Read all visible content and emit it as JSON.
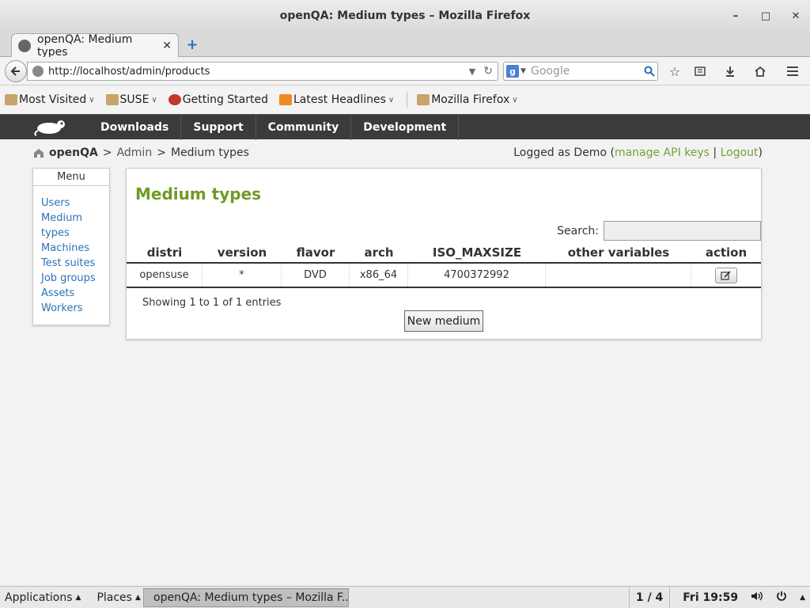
{
  "window": {
    "title": "openQA: Medium types – Mozilla Firefox",
    "minimize": "–",
    "maximize": "□",
    "close": "✕"
  },
  "tab": {
    "label": "openQA: Medium types",
    "close": "✕",
    "new_tab": "+"
  },
  "nav": {
    "url": "http://localhost/admin/products",
    "search_placeholder": "Google",
    "search_engine_letter": "g"
  },
  "bookmarks": [
    {
      "label": "Most Visited",
      "icon": "most-visited-icon",
      "dropdown": true
    },
    {
      "label": "SUSE",
      "icon": "folder-icon",
      "dropdown": true
    },
    {
      "label": "Getting Started",
      "icon": "chameleon-icon",
      "dropdown": false
    },
    {
      "label": "Latest Headlines",
      "icon": "rss-icon",
      "dropdown": true
    },
    {
      "label": "Mozilla Firefox",
      "icon": "folder-icon",
      "dropdown": true
    }
  ],
  "site_nav": [
    "Downloads",
    "Support",
    "Community",
    "Development"
  ],
  "breadcrumb": {
    "home": "openQA",
    "sep": ">",
    "admin": "Admin",
    "current": "Medium types"
  },
  "login": {
    "prefix": "Logged as Demo (",
    "api_keys": "manage API keys",
    "divider": " | ",
    "logout": "Logout",
    "suffix": ")"
  },
  "menu": {
    "heading": "Menu",
    "items": [
      "Users",
      "Medium types",
      "Machines",
      "Test suites",
      "Job groups",
      "Assets",
      "Workers"
    ]
  },
  "panel": {
    "title": "Medium types",
    "search_label": "Search:",
    "columns": [
      "distri",
      "version",
      "flavor",
      "arch",
      "ISO_MAXSIZE",
      "other variables",
      "action"
    ],
    "rows": [
      [
        "opensuse",
        "*",
        "DVD",
        "x86_64",
        "4700372992",
        "",
        ""
      ]
    ],
    "info": "Showing 1 to 1 of 1 entries",
    "new_button": "New medium"
  },
  "taskbar": {
    "applications": "Applications",
    "places": "Places",
    "window_label": "openQA: Medium types – Mozilla F...",
    "workspace": "1 / 4",
    "clock": "Fri 19:59"
  },
  "colors": {
    "accent_green": "#6f9b26",
    "link_blue": "#2a73b5",
    "nav_dark": "#3b3b3b"
  }
}
